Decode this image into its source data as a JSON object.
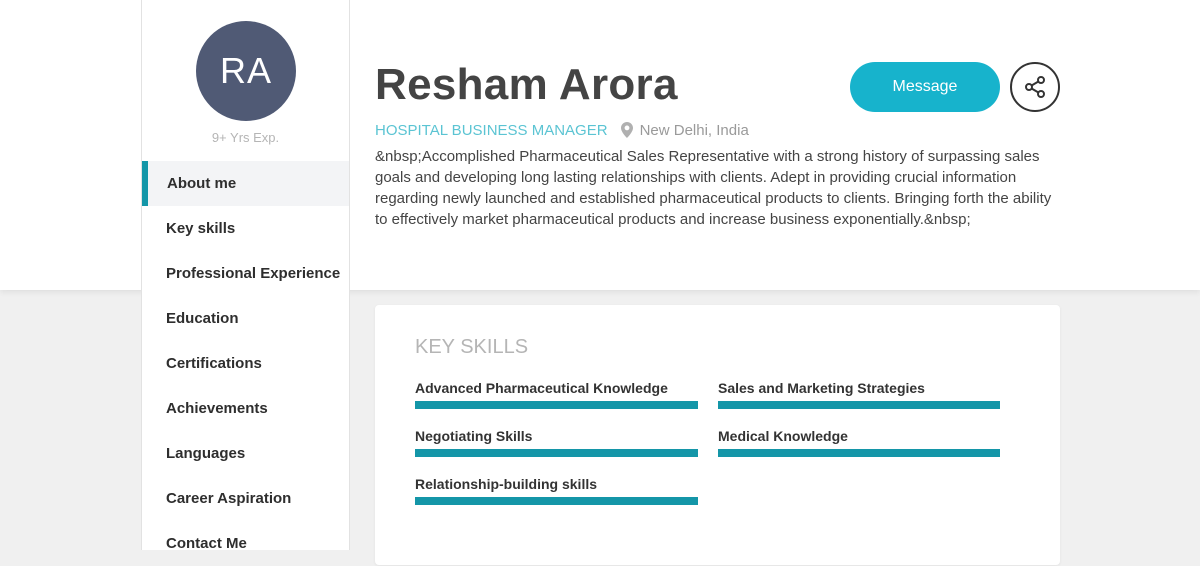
{
  "profile": {
    "initials": "RA",
    "experience": "9+ Yrs Exp.",
    "name": "Resham Arora",
    "role": "HOSPITAL BUSINESS MANAGER",
    "location": "New Delhi, India",
    "bio": "&nbsp;Accomplished Pharmaceutical Sales Representative with a strong history of surpassing sales goals and developing long lasting relationships with clients. Adept in providing crucial information regarding newly launched and established pharmaceutical products to clients. Bringing forth the ability to effectively market pharmaceutical products and increase business exponentially.&nbsp;"
  },
  "actions": {
    "message_label": "Message",
    "share_icon": "share-icon"
  },
  "sidebar": {
    "items": [
      {
        "label": "About me"
      },
      {
        "label": "Key skills"
      },
      {
        "label": "Professional Experience"
      },
      {
        "label": "Education"
      },
      {
        "label": "Certifications"
      },
      {
        "label": "Achievements"
      },
      {
        "label": "Languages"
      },
      {
        "label": "Career Aspiration"
      },
      {
        "label": "Contact Me"
      }
    ]
  },
  "skills": {
    "title": "KEY SKILLS",
    "items": [
      {
        "label": "Advanced Pharmaceutical Knowledge"
      },
      {
        "label": "Sales and Marketing Strategies"
      },
      {
        "label": "Negotiating Skills"
      },
      {
        "label": "Medical Knowledge"
      },
      {
        "label": "Relationship-building skills"
      }
    ]
  },
  "colors": {
    "accent": "#17b3cc",
    "bar": "#1496a8",
    "avatar": "#505a75"
  }
}
